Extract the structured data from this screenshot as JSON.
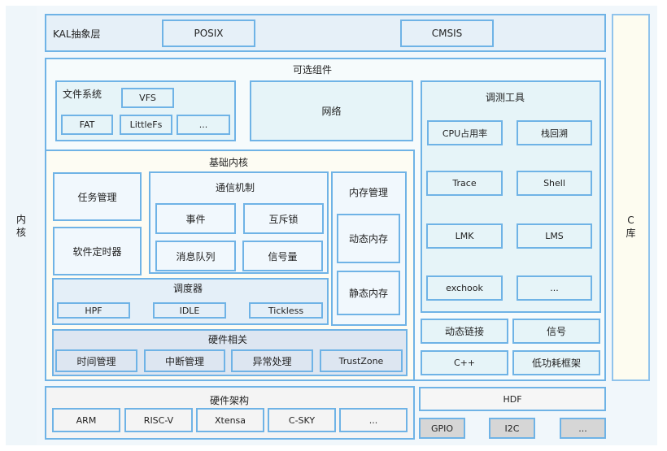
{
  "side_labels": {
    "kernel": [
      "内",
      "核"
    ],
    "c_lib": [
      "C",
      "库"
    ]
  },
  "kal": {
    "title": "KAL抽象层",
    "items": [
      "POSIX",
      "CMSIS"
    ]
  },
  "optional": {
    "title": "可选组件",
    "filesystem": {
      "title": "文件系统",
      "vfs": "VFS",
      "items": [
        "FAT",
        "LittleFs",
        "..."
      ]
    },
    "network": "网络",
    "debug": {
      "title": "调测工具",
      "items": [
        "CPU占用率",
        "栈回溯",
        "Trace",
        "Shell",
        "LMK",
        "LMS",
        "exchook",
        "..."
      ]
    },
    "extras": [
      "动态链接",
      "信号",
      "C++",
      "低功耗框架"
    ]
  },
  "basic_kernel": {
    "title": "基础内核",
    "task": "任务管理",
    "timer": "软件定时器",
    "ipc": {
      "title": "通信机制",
      "items": [
        "事件",
        "互斥锁",
        "消息队列",
        "信号量"
      ]
    },
    "memory": {
      "title": "内存管理",
      "items": [
        "动态内存",
        "静态内存"
      ]
    },
    "scheduler": {
      "title": "调度器",
      "items": [
        "HPF",
        "IDLE",
        "Tickless"
      ]
    },
    "hardware": {
      "title": "硬件相关",
      "items": [
        "时间管理",
        "中断管理",
        "异常处理",
        "TrustZone"
      ]
    }
  },
  "arch": {
    "title": "硬件架构",
    "items": [
      "ARM",
      "RISC-V",
      "Xtensa",
      "C-SKY",
      "..."
    ]
  },
  "hdf": {
    "title": "HDF",
    "items": [
      "GPIO",
      "I2C",
      "..."
    ]
  },
  "colors": {
    "border": "#6fb3e6",
    "kal_bg": "#e6f0f8",
    "optional_bg": "#f6fbfc",
    "debug_bg": "#e6f4f8",
    "kernel_bg": "#fdfcf3",
    "kernel_box_bg": "#f1f8fd",
    "scheduler_bg": "#e4eff8",
    "hardware_bg": "#dde6f1",
    "arch_bg": "#f4f4f4",
    "gray_item": "#d6d6d6",
    "clib_bg": "#fdfcf0"
  }
}
